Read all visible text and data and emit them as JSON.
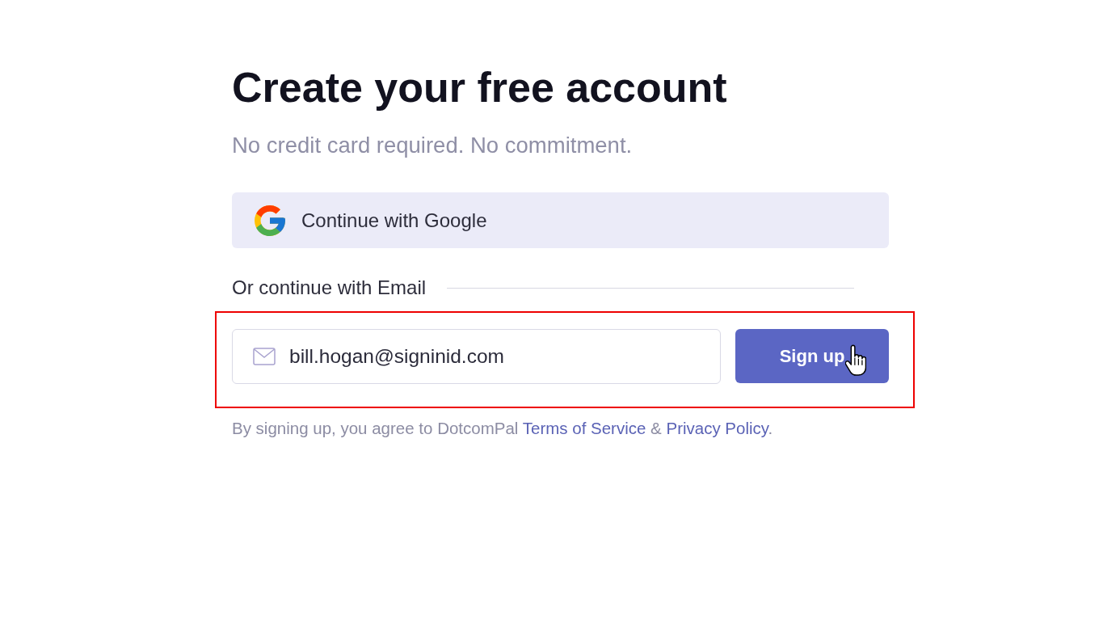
{
  "heading": "Create your free account",
  "subheading": "No credit card required. No commitment.",
  "google_button": {
    "label": "Continue with Google"
  },
  "divider": {
    "label": "Or continue with Email"
  },
  "email_form": {
    "highlighted": true,
    "email_field": {
      "value": "bill.hogan@signinid.com"
    },
    "submit_button": {
      "label": "Sign up",
      "hovered": true
    }
  },
  "legal_note": [
    {
      "kind": "text",
      "text": "By signing up, you agree to DotcomPal "
    },
    {
      "kind": "link",
      "text": "Terms of Service"
    },
    {
      "kind": "text",
      "text": " & "
    },
    {
      "kind": "link",
      "text": "Privacy Policy"
    },
    {
      "kind": "text",
      "text": "."
    }
  ]
}
